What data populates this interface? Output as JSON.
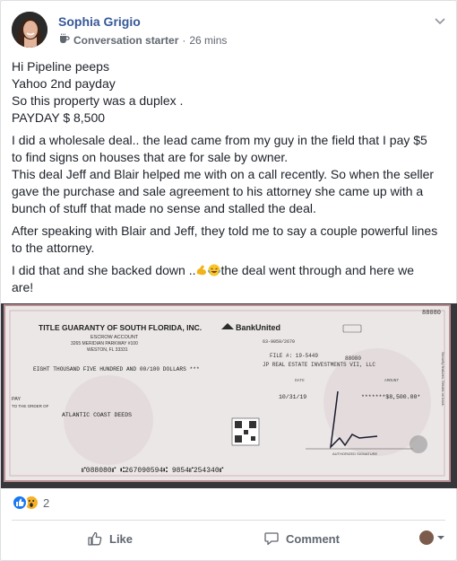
{
  "post": {
    "author": "Sophia Grigio",
    "badge": "Conversation starter",
    "separator": "·",
    "time": "26 mins",
    "intro_lines": [
      "Hi Pipeline peeps",
      "Yahoo 2nd payday",
      "So this property was a duplex .",
      "PAYDAY $ 8,500"
    ],
    "para1_lines": [
      "I did a wholesale deal.. the lead came from my guy in the field that I pay $5",
      "to find signs on houses that are for sale by owner.",
      "This deal Jeff and Blair helped me with on a call recently. So when the seller",
      "gave the purchase and sale agreement to his attorney she came up with a",
      "bunch of stuff that made no sense and stalled the deal."
    ],
    "para2_lines": [
      "After speaking with Blair and Jeff, they told me to say a couple powerful lines",
      "to the attorney."
    ],
    "para3_start": "I did that and she backed down ..",
    "para3_end": "the deal went through and here we",
    "para3_line2": "are!"
  },
  "check": {
    "payer": "TITLE GUARANTY OF SOUTH FLORIDA, INC.",
    "account": "ESCROW ACCOUNT",
    "address1": "3265 MERIDIAN PARKWAY #100",
    "address2": "WESTON, FL 33331",
    "bank": "BankUnited",
    "routing_frac": "63-9059/2670",
    "check_number": "88080",
    "file_no": "FILE #: 19-5449",
    "ref_number": "88080",
    "memo_line": "JP REAL ESTATE INVESTMENTS VII, LLC",
    "amount_words": "EIGHT THOUSAND FIVE HUNDRED AND 00/100 DOLLARS ***",
    "date_label": "DATE",
    "amount_label": "AMOUNT",
    "date": "10/31/19",
    "amount": "*******$8,500.00*",
    "pay_label": "PAY",
    "to_order_label": "TO THE ORDER OF",
    "payee": "ATLANTIC COAST DEEDS",
    "signature_label": "AUTHORIZED SIGNATURE",
    "micr": "⑈088080⑈ ⑆267090594⑆ 9854⑈254340⑈",
    "side_note": "Security features. Details on back."
  },
  "reactions": {
    "count": "2",
    "types": [
      "like",
      "wow"
    ]
  },
  "actions": {
    "like": "Like",
    "comment": "Comment"
  },
  "icons": {
    "chevron": "chevron-down-icon",
    "badge": "coffee-cup-icon"
  },
  "colors": {
    "author": "#365899",
    "meta": "#606770",
    "like_blue": "#1877f2",
    "wow_yellow": "#f7b125"
  }
}
